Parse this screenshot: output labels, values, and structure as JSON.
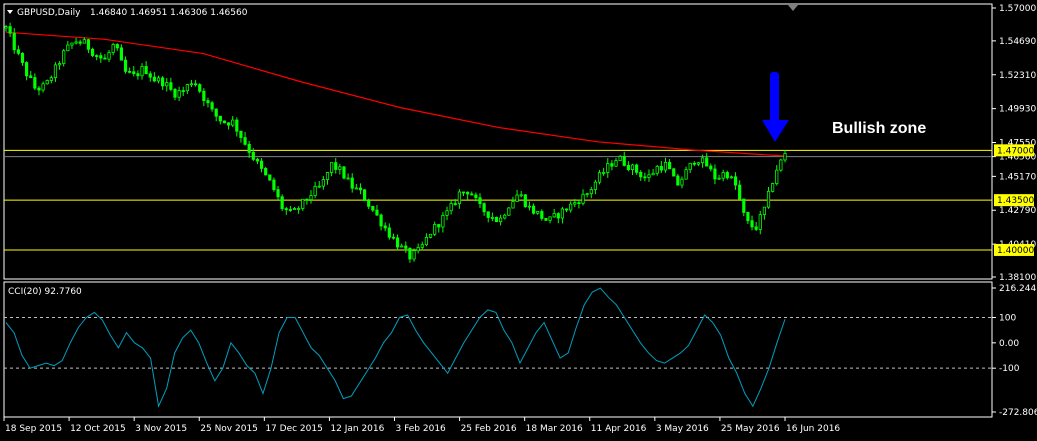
{
  "chart_data": [
    {
      "type": "candlestick",
      "title": "GBPUSD,Daily",
      "ohlc_label": "1.46840 1.46951 1.46306 1.46560",
      "y_ticks": [
        "1.57000",
        "1.54690",
        "1.52310",
        "1.49930",
        "1.47550",
        "1.46560",
        "1.45170",
        "1.42790",
        "1.40410",
        "1.38100"
      ],
      "ylim": [
        1.381,
        1.57
      ],
      "x_ticks": [
        "18 Sep 2015",
        "12 Oct 2015",
        "3 Nov 2015",
        "25 Nov 2015",
        "17 Dec 2015",
        "12 Jan 2016",
        "3 Feb 2016",
        "25 Feb 2016",
        "18 Mar 2016",
        "11 Apr 2016",
        "3 May 2016",
        "25 May 2016",
        "16 Jun 2016"
      ],
      "price_path": [
        [
          0,
          1.556
        ],
        [
          1,
          1.54
        ],
        [
          2,
          1.525
        ],
        [
          3,
          1.513
        ],
        [
          4,
          1.515
        ],
        [
          5,
          1.527
        ],
        [
          6,
          1.54
        ],
        [
          7,
          1.547
        ],
        [
          8,
          1.545
        ],
        [
          9,
          1.538
        ],
        [
          10,
          1.533
        ],
        [
          11,
          1.545
        ],
        [
          12,
          1.525
        ],
        [
          13,
          1.522
        ],
        [
          14,
          1.528
        ],
        [
          15,
          1.52
        ],
        [
          16,
          1.518
        ],
        [
          17,
          1.51
        ],
        [
          18,
          1.512
        ],
        [
          19,
          1.52
        ],
        [
          20,
          1.508
        ],
        [
          21,
          1.496
        ],
        [
          22,
          1.49
        ],
        [
          23,
          1.49
        ],
        [
          24,
          1.478
        ],
        [
          25,
          1.466
        ],
        [
          26,
          1.455
        ],
        [
          27,
          1.445
        ],
        [
          28,
          1.43
        ],
        [
          29,
          1.425
        ],
        [
          30,
          1.432
        ],
        [
          31,
          1.44
        ],
        [
          32,
          1.445
        ],
        [
          33,
          1.46
        ],
        [
          34,
          1.455
        ],
        [
          35,
          1.445
        ],
        [
          36,
          1.44
        ],
        [
          37,
          1.43
        ],
        [
          38,
          1.42
        ],
        [
          39,
          1.41
        ],
        [
          40,
          1.402
        ],
        [
          41,
          1.395
        ],
        [
          42,
          1.4
        ],
        [
          43,
          1.412
        ],
        [
          44,
          1.42
        ],
        [
          45,
          1.428
        ],
        [
          46,
          1.44
        ],
        [
          47,
          1.442
        ],
        [
          48,
          1.43
        ],
        [
          49,
          1.425
        ],
        [
          50,
          1.42
        ],
        [
          51,
          1.432
        ],
        [
          52,
          1.44
        ],
        [
          53,
          1.43
        ],
        [
          54,
          1.425
        ],
        [
          55,
          1.42
        ],
        [
          56,
          1.425
        ],
        [
          57,
          1.43
        ],
        [
          58,
          1.435
        ],
        [
          59,
          1.44
        ],
        [
          60,
          1.45
        ],
        [
          61,
          1.458
        ],
        [
          62,
          1.465
        ],
        [
          63,
          1.46
        ],
        [
          64,
          1.455
        ],
        [
          65,
          1.45
        ],
        [
          66,
          1.458
        ],
        [
          67,
          1.46
        ],
        [
          68,
          1.445
        ],
        [
          69,
          1.455
        ],
        [
          70,
          1.465
        ],
        [
          71,
          1.46
        ],
        [
          72,
          1.45
        ],
        [
          73,
          1.455
        ],
        [
          74,
          1.445
        ],
        [
          75,
          1.42
        ],
        [
          76,
          1.415
        ],
        [
          77,
          1.43
        ],
        [
          78,
          1.455
        ],
        [
          79,
          1.467
        ]
      ],
      "ma_path": [
        [
          0,
          1.553
        ],
        [
          10,
          1.548
        ],
        [
          20,
          1.538
        ],
        [
          30,
          1.518
        ],
        [
          40,
          1.5
        ],
        [
          50,
          1.486
        ],
        [
          60,
          1.476
        ],
        [
          70,
          1.47
        ],
        [
          79,
          1.466
        ]
      ],
      "hlines": [
        {
          "label": "1.47000",
          "value": 1.47,
          "color": "#ffff00"
        },
        {
          "label": "1.43500",
          "value": 1.435,
          "color": "#ffff00"
        },
        {
          "label": "1.40000",
          "value": 1.4,
          "color": "#ffff00"
        }
      ],
      "current_price_line": 1.4656,
      "annotation": "Bullish zone",
      "colors": {
        "candles": "#00ff00",
        "ma": "#ff0000",
        "levels": "#ffff00",
        "arrow": "#0000ff"
      }
    },
    {
      "type": "line",
      "title": "CCI(20) 92.7760",
      "y_ticks": [
        "216.2447",
        "100",
        "0.00",
        "-100",
        "-272.8061"
      ],
      "ylim": [
        -272.8061,
        216.2447
      ],
      "levels": [
        100,
        -100
      ],
      "values": [
        80,
        40,
        -50,
        -100,
        -90,
        -80,
        -90,
        -70,
        0,
        60,
        100,
        120,
        90,
        30,
        -20,
        40,
        0,
        -20,
        -60,
        -250,
        -180,
        -40,
        20,
        50,
        0,
        -80,
        -150,
        -100,
        0,
        -40,
        -90,
        -120,
        -200,
        -100,
        40,
        100,
        100,
        40,
        -20,
        -50,
        -100,
        -150,
        -220,
        -210,
        -160,
        -110,
        -60,
        0,
        40,
        100,
        110,
        50,
        0,
        -40,
        -80,
        -120,
        -60,
        0,
        50,
        100,
        130,
        120,
        50,
        0,
        -80,
        -20,
        40,
        80,
        10,
        -60,
        -40,
        60,
        150,
        200,
        216,
        180,
        150,
        100,
        50,
        0,
        -40,
        -70,
        -80,
        -60,
        -40,
        -10,
        50,
        110,
        80,
        30,
        -60,
        -120,
        -200,
        -250,
        -180,
        -100,
        0,
        93
      ],
      "colors": {
        "line": "#00a0c0"
      }
    }
  ]
}
